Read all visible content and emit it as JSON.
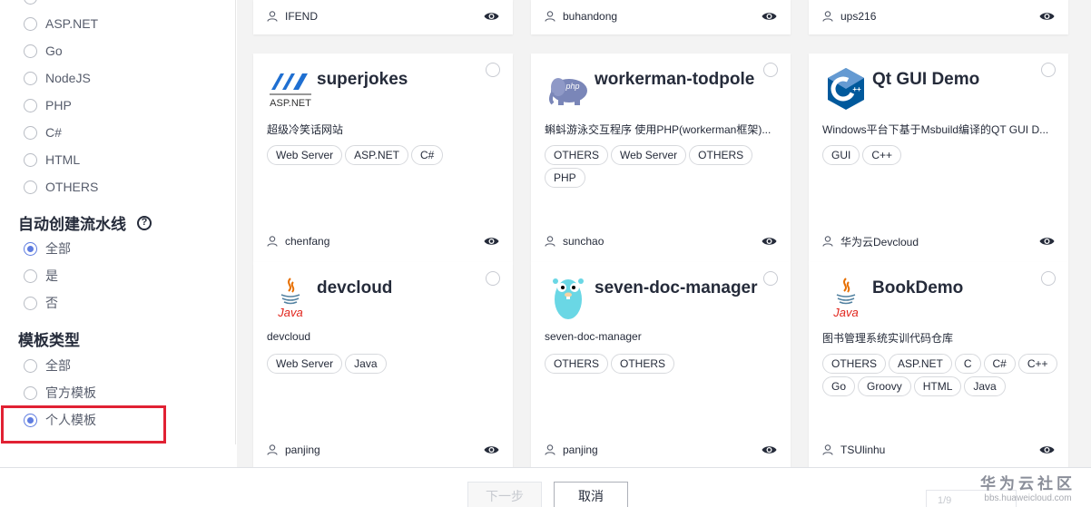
{
  "sidebar": {
    "language_options": [
      "ASP.NET",
      "Go",
      "NodeJS",
      "PHP",
      "C#",
      "HTML",
      "OTHERS"
    ],
    "pipeline_section": {
      "title": "自动创建流水线",
      "help": "?",
      "options": [
        "全部",
        "是",
        "否"
      ],
      "selected_index": 0
    },
    "template_section": {
      "title": "模板类型",
      "options": [
        "全部",
        "官方模板",
        "个人模板"
      ],
      "selected_index": 2
    }
  },
  "top_row": [
    {
      "author": "IFEND"
    },
    {
      "author": "buhandong"
    },
    {
      "author": "ups216"
    }
  ],
  "cards": [
    {
      "title": "superjokes",
      "logo": "aspnet-logo",
      "logo_text": "ASP.NET",
      "desc": "超级冷笑话网站",
      "tags": [
        "Web Server",
        "ASP.NET",
        "C#"
      ],
      "author": "chenfang"
    },
    {
      "title": "workerman-todpole",
      "logo": "php-elephant-logo",
      "logo_text": "php",
      "desc": "蝌蚪游泳交互程序 使用PHP(workerman框架)...",
      "tags": [
        "OTHERS",
        "Web Server",
        "OTHERS",
        "PHP"
      ],
      "author": "sunchao"
    },
    {
      "title": "Qt GUI Demo",
      "logo": "cplusplus-logo",
      "logo_text": "C++",
      "desc": "Windows平台下基于Msbuild编译的QT GUI D...",
      "tags": [
        "GUI",
        "C++"
      ],
      "author": "华为云Devcloud"
    },
    {
      "title": "devcloud",
      "logo": "java-logo",
      "logo_text": "Java",
      "desc": "devcloud",
      "tags": [
        "Web Server",
        "Java"
      ],
      "author": "panjing"
    },
    {
      "title": "seven-doc-manager",
      "logo": "go-gopher-logo",
      "logo_text": "",
      "desc": "seven-doc-manager",
      "tags": [
        "OTHERS",
        "OTHERS"
      ],
      "author": "panjing"
    },
    {
      "title": "BookDemo",
      "logo": "java-logo",
      "logo_text": "Java",
      "desc": "图书管理系统实训代码仓库",
      "tags": [
        "OTHERS",
        "ASP.NET",
        "C",
        "C#",
        "C++",
        "Go",
        "Groovy",
        "HTML",
        "Java"
      ],
      "author": "TSUlinhu"
    }
  ],
  "footer": {
    "next_label": "下一步",
    "cancel_label": "取消",
    "pager_text": "1/9"
  },
  "watermark": {
    "line1": "华为云社区",
    "line2": "bbs.huaweicloud.com"
  },
  "colors": {
    "accent": "#5e7ce0",
    "highlight": "#e12133",
    "background": "#f3f3f3"
  }
}
